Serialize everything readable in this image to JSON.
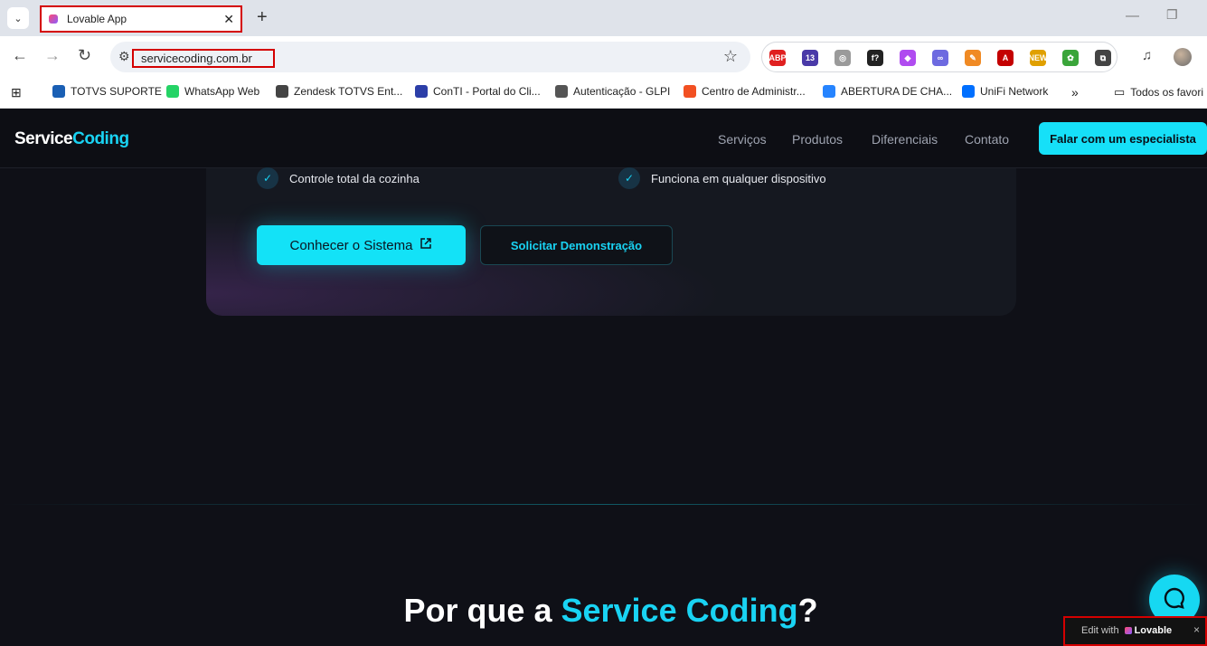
{
  "browser": {
    "tab_title": "Lovable App",
    "tab_close": "✕",
    "new_tab": "+",
    "url": "servicecoding.com.br",
    "bookmarks": [
      {
        "label": "TOTVS SUPORTE",
        "color": "#1a5fb4"
      },
      {
        "label": "WhatsApp Web",
        "color": "#25d366"
      },
      {
        "label": "Zendesk TOTVS  Ent...",
        "color": "#444444"
      },
      {
        "label": "ConTI - Portal do Cli...",
        "color": "#2c3ea8"
      },
      {
        "label": "Autenticação - GLPI",
        "color": "#555555"
      },
      {
        "label": "Centro de Administr...",
        "color": "#f25022"
      },
      {
        "label": "ABERTURA DE CHA...",
        "color": "#2684ff"
      },
      {
        "label": "UniFi Network",
        "color": "#006fff"
      }
    ],
    "bookmarks_more": "»",
    "all_bookmarks": "Todos os favori"
  },
  "extensions": [
    {
      "name": "adblock-icon",
      "label": "ABP",
      "color": "#e02020"
    },
    {
      "name": "badge-13-icon",
      "label": "13",
      "color": "#4a3aa8"
    },
    {
      "name": "compass-icon",
      "label": "◎",
      "color": "#9a9a9a"
    },
    {
      "name": "function-icon",
      "label": "f?",
      "color": "#222222"
    },
    {
      "name": "purple-ext-icon",
      "label": "◆",
      "color": "#b04cf0"
    },
    {
      "name": "glasses-icon",
      "label": "∞",
      "color": "#6d6ae0"
    },
    {
      "name": "pen-icon",
      "label": "✎",
      "color": "#f08a24"
    },
    {
      "name": "pdf-icon",
      "label": "A",
      "color": "#c40000"
    },
    {
      "name": "new-ext-icon",
      "label": "NEW",
      "color": "#e0a000"
    },
    {
      "name": "color-ext-icon",
      "label": "✿",
      "color": "#3aa53a"
    },
    {
      "name": "puzzle-icon",
      "label": "⧉",
      "color": "#444444"
    }
  ],
  "site": {
    "logo_part1": "Service",
    "logo_part2": "Coding",
    "menu": [
      "Serviços",
      "Produtos",
      "Diferenciais",
      "Contato"
    ],
    "cta": "Falar com um especialista",
    "feature_left": "Controle total da cozinha",
    "feature_right": "Funciona em qualquer dispositivo",
    "btn_primary": "Conhecer o Sistema",
    "btn_secondary": "Solicitar Demonstração",
    "headline_part1": "Por que a ",
    "headline_highlight": "Service Coding",
    "headline_part2": "?",
    "accent_color": "#19d3f3"
  },
  "lovable_badge": {
    "prefix": "Edit with",
    "brand": "Lovable",
    "close": "×"
  }
}
